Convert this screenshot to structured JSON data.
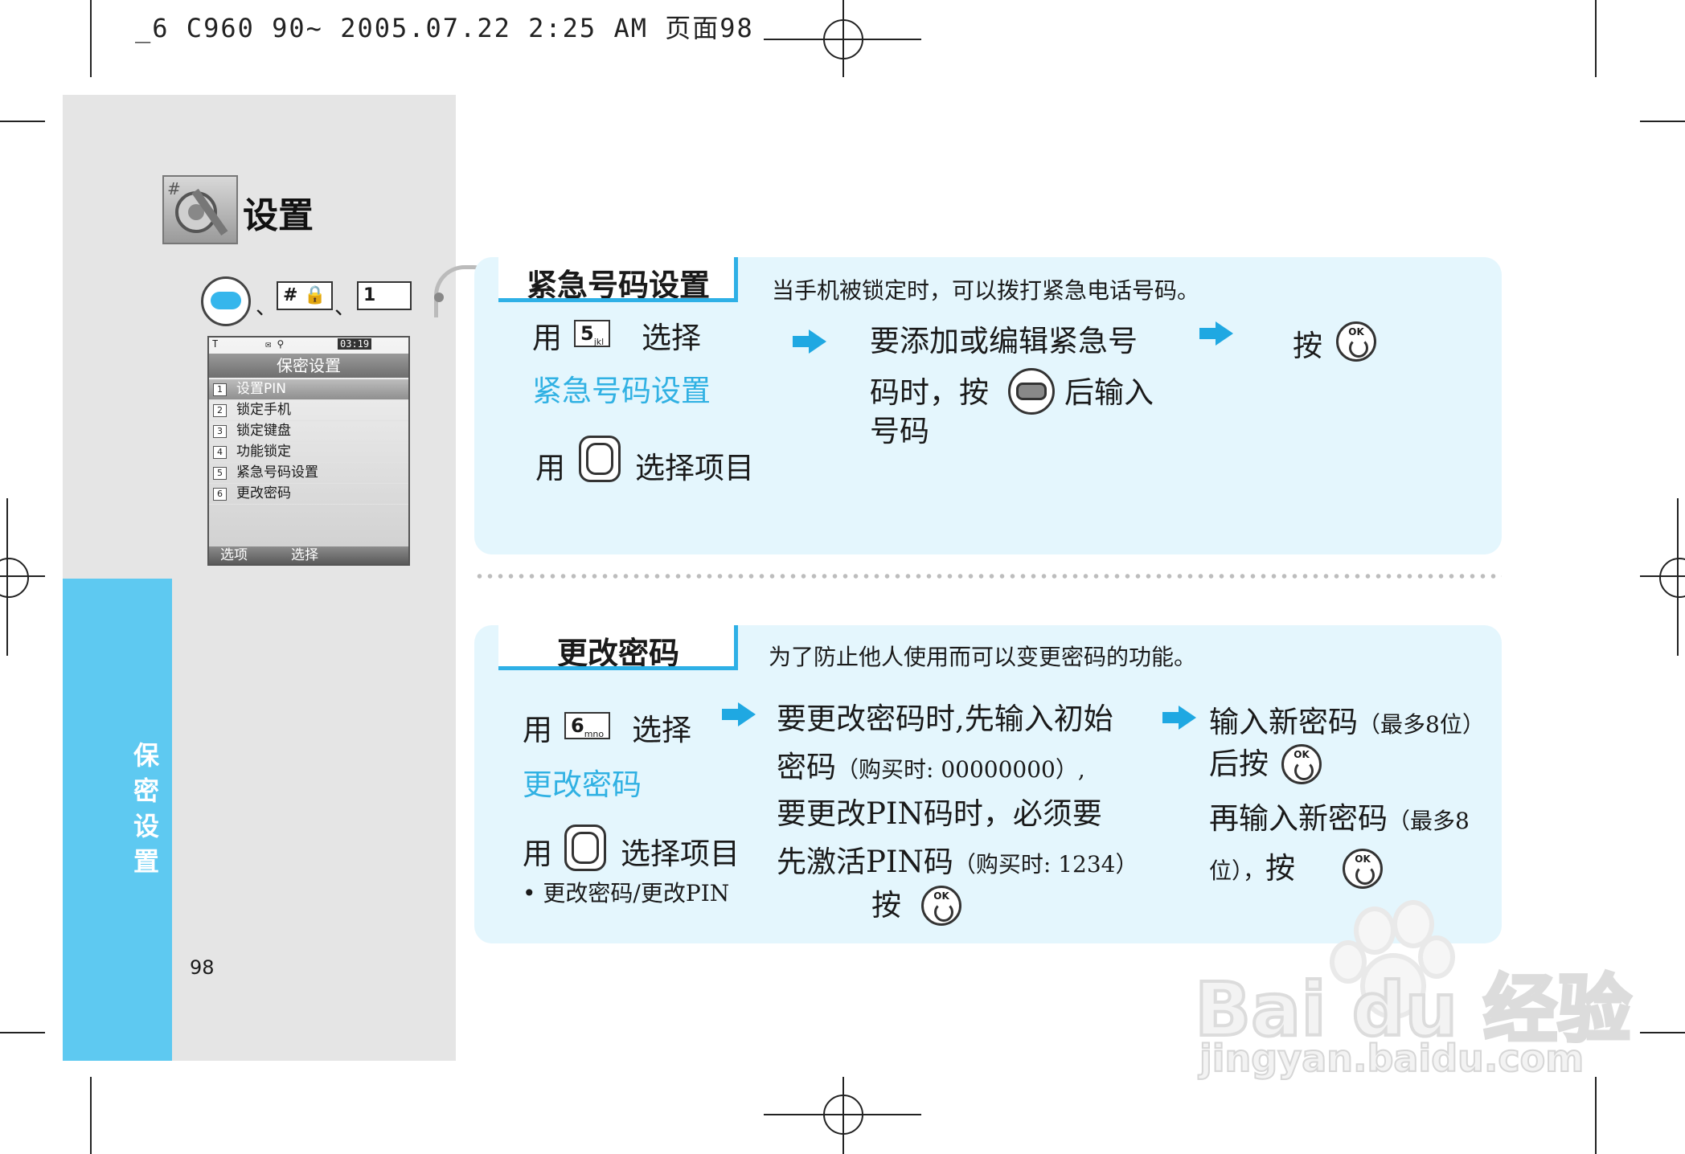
{
  "print_header": "_6 C960 90~ 2005.07.22 2:25 AM 页面98",
  "sidebar": {
    "section_title": "设置",
    "side_tab": "保密设置",
    "page_number": "98",
    "sequence": {
      "sep1": "、",
      "hash_key": "# 🔒",
      "sep2": "、",
      "one_key": "1"
    }
  },
  "phone_screen": {
    "clock": "03:19",
    "title": "保密设置",
    "items": [
      {
        "num": "1",
        "label": "设置PIN"
      },
      {
        "num": "2",
        "label": "锁定手机"
      },
      {
        "num": "3",
        "label": "锁定键盘"
      },
      {
        "num": "4",
        "label": "功能锁定"
      },
      {
        "num": "5",
        "label": "紧急号码设置"
      },
      {
        "num": "6",
        "label": "更改密码"
      }
    ],
    "soft_left": "选项",
    "soft_right": "选择"
  },
  "section1": {
    "heading": "紧急号码设置",
    "description": "当手机被锁定时，可以拨打紧急电话号码。",
    "key_digit": "5",
    "key_sub": "jkl",
    "use1": "用",
    "select": "选择",
    "target": "紧急号码设置",
    "use2": "用",
    "select_item": "选择项目",
    "step2_line1": "要添加或编辑紧急号",
    "step2_line2a": "码时，按",
    "step2_line2b": "后输入",
    "step2_line3": "号码",
    "step3": "按"
  },
  "section2": {
    "heading": "更改密码",
    "description": "为了防止他人使用而可以变更密码的功能。",
    "key_digit": "6",
    "key_sub": "mno",
    "use1": "用",
    "select": "选择",
    "target": "更改密码",
    "use2": "用",
    "select_item": "选择项目",
    "note": "• 更改密码/更改PIN",
    "step2_line1": "要更改密码时,先输入初始",
    "step2_line2": "密码",
    "step2_line2_small": "（购买时: 00000000）,",
    "step2_line3": "要更改PIN码时，必须要",
    "step2_line4": "先激活PIN码",
    "step2_line4_small": "（购买时: 1234）",
    "step2_press": "按",
    "step3_line1": "输入新密码",
    "step3_line1_small": "（最多8位）",
    "step3_line2": "后按",
    "step3_line3": "再输入新密码",
    "step3_line3_small": "（最多8",
    "step3_line4_small": "位），",
    "step3_line4": "按"
  },
  "watermark": {
    "brand": "Bai du 经验",
    "url": "jingyan.baidu.com"
  },
  "colors": {
    "accent": "#30b1e3",
    "panel_bg": "#e4f6fd",
    "side_tab": "#5ec9f1",
    "sidebar_bg": "#e5e5e5"
  },
  "icons": [
    "settings-tools-icon",
    "menu-key-icon",
    "lock-icon",
    "ok-key-icon",
    "nav-key-icon",
    "arrow-right-icon"
  ]
}
